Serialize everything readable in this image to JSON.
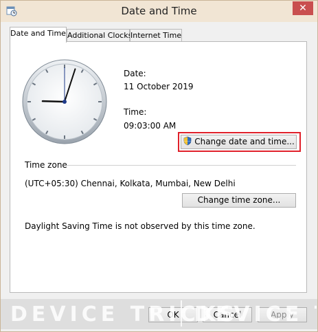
{
  "window": {
    "title": "Date and Time",
    "close_glyph": "✕"
  },
  "tabs": [
    {
      "label": "Date and Time"
    },
    {
      "label": "Additional Clocks"
    },
    {
      "label": "Internet Time"
    }
  ],
  "datetime": {
    "date_label": "Date:",
    "date_value": "11 October 2019",
    "time_label": "Time:",
    "time_value": "09:03:00 AM",
    "change_button": "Change date and time..."
  },
  "clock": {
    "hours": 9,
    "minutes": 3,
    "seconds": 0
  },
  "timezone": {
    "section_label": "Time zone",
    "value": "(UTC+05:30) Chennai, Kolkata, Mumbai, New Delhi",
    "change_button": "Change time zone...",
    "dst_note": "Daylight Saving Time is not observed by this time zone."
  },
  "buttons": {
    "ok": "OK",
    "cancel": "Cancel",
    "apply": "Apply"
  },
  "watermark": {
    "text_left": "DEVICE TRICKS",
    "text_right": "DEVICE TRIC"
  },
  "colors": {
    "highlight": "#e0202a",
    "titlebar": "#f1e5d4",
    "close": "#c94f4f"
  }
}
